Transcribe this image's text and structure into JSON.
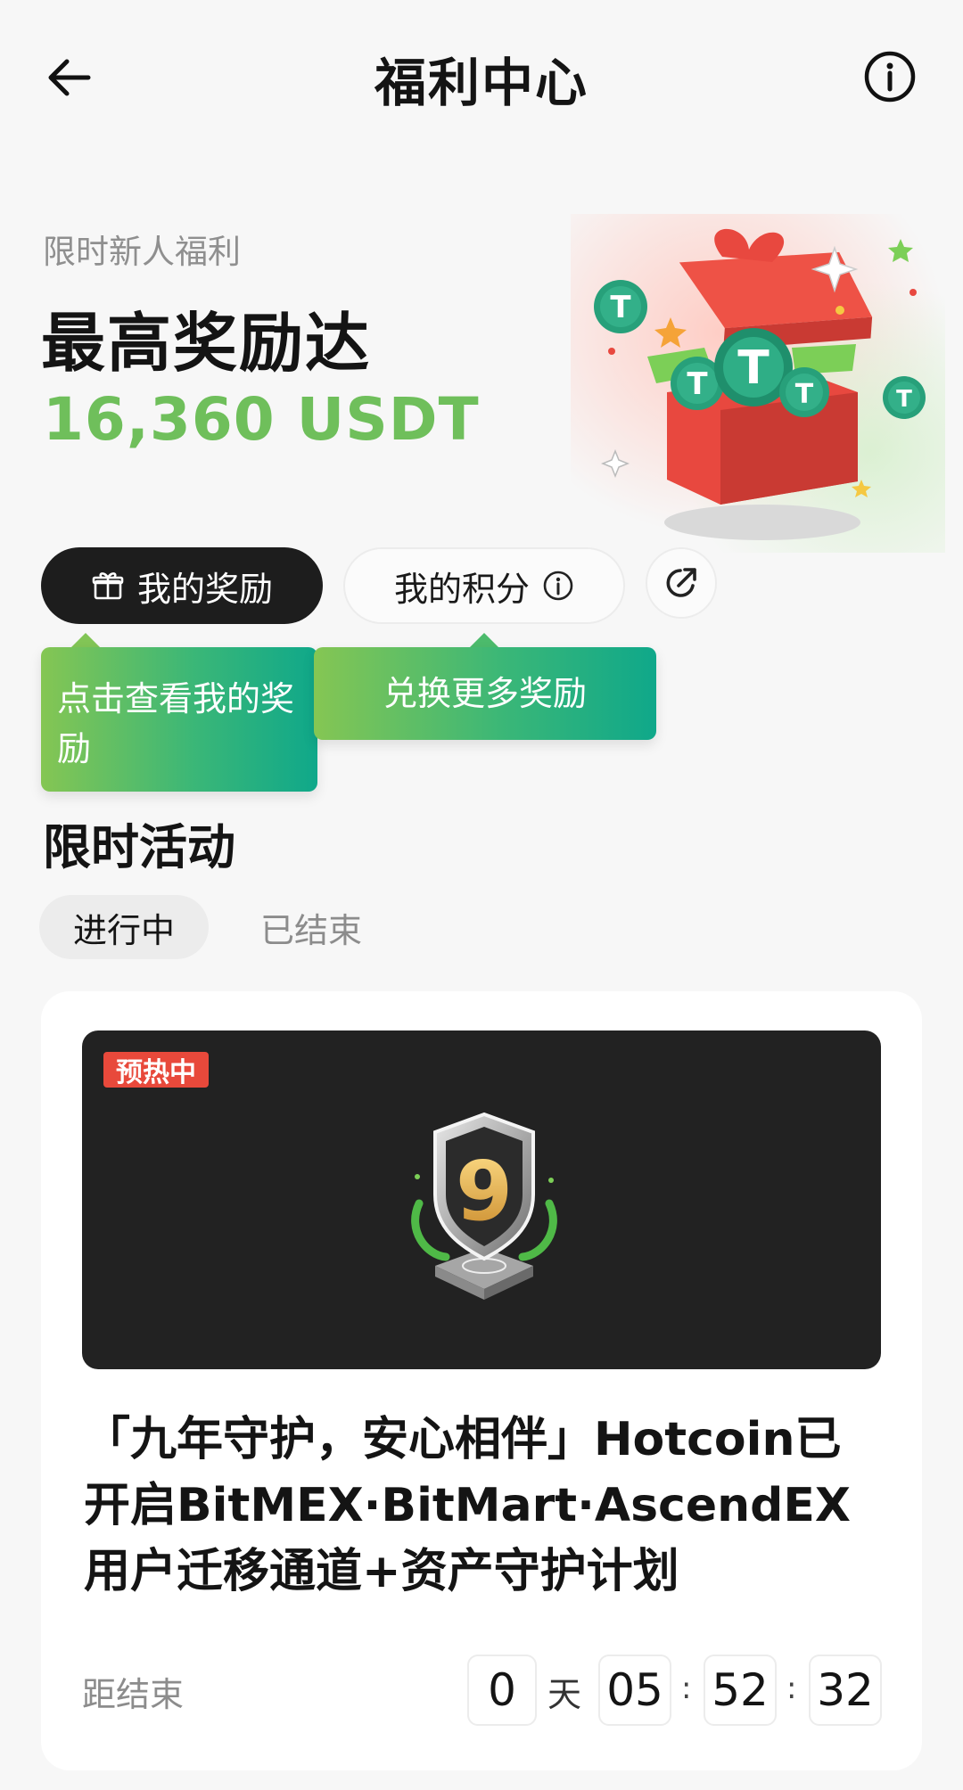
{
  "header": {
    "title": "福利中心",
    "back_icon": "arrow-left-icon",
    "info_icon": "info-circle-icon"
  },
  "hero": {
    "subtitle": "限时新人福利",
    "title": "最高奖励达",
    "amount": "16,360 USDT",
    "amount_color": "#6fbf5b"
  },
  "pills": {
    "my_rewards": "我的奖励",
    "my_points": "我的积分",
    "rewards_icon": "gift-icon",
    "points_icon": "info-circle-icon",
    "share_icon": "share-arrow-icon"
  },
  "tooltips": {
    "rewards_tip": "点击查看我的奖励",
    "points_tip": "兑换更多奖励"
  },
  "section": {
    "title": "限时活动",
    "tabs": [
      {
        "label": "进行中",
        "active": true
      },
      {
        "label": "已结束",
        "active": false
      }
    ]
  },
  "card": {
    "badge": "预热中",
    "shield_number": "9",
    "title": "「九年守护，安心相伴」Hotcoin已开启BitMEX·BitMart·AscendEX用户迁移通道+资产守护计划",
    "countdown": {
      "label": "距结束",
      "days": "0",
      "days_unit": "天",
      "hours": "05",
      "minutes": "52",
      "seconds": "32",
      "separator": ":"
    }
  },
  "colors": {
    "accent_green": "#6fbf5b",
    "badge_red": "#e8493b",
    "tooltip_gradient": [
      "#85c653",
      "#0fa88a"
    ]
  }
}
